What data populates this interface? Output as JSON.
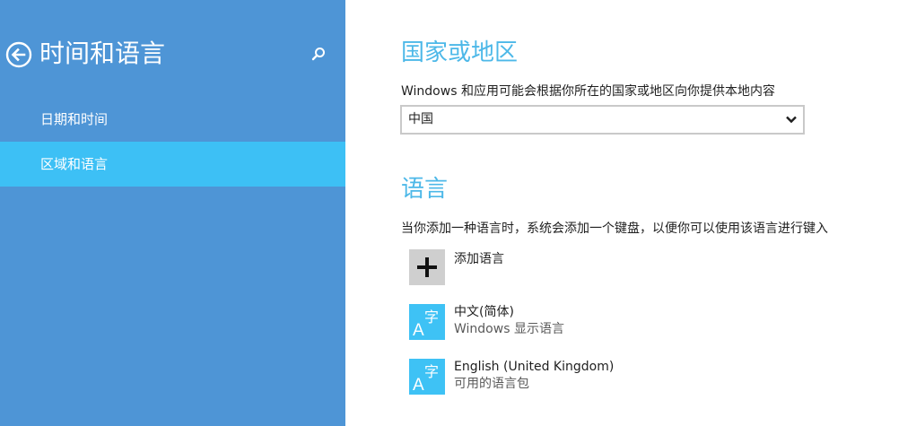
{
  "sidebar": {
    "title": "时间和语言",
    "items": [
      {
        "label": "日期和时间",
        "selected": false
      },
      {
        "label": "区域和语言",
        "selected": true
      }
    ]
  },
  "region": {
    "title": "国家或地区",
    "description": "Windows 和应用可能会根据你所在的国家或地区向你提供本地内容",
    "selected_value": "中国"
  },
  "language": {
    "title": "语言",
    "description": "当你添加一种语言时，系统会添加一个键盘，以便你可以使用该语言进行键入",
    "add_label": "添加语言",
    "items": [
      {
        "name": "中文(简体)",
        "sub": "Windows 显示语言"
      },
      {
        "name": "English (United Kingdom)",
        "sub": "可用的语言包"
      }
    ]
  },
  "colors": {
    "sidebar_bg": "#4e95d6",
    "selected_item_bg": "#3dc0f5",
    "accent_title": "#4db8e8",
    "language_tile": "#3ec2f5"
  },
  "icons": {
    "back": "back-arrow-icon",
    "search": "search-icon",
    "dropdown": "chevron-down-icon",
    "add": "plus-icon",
    "language": "language-glyph-icon"
  }
}
